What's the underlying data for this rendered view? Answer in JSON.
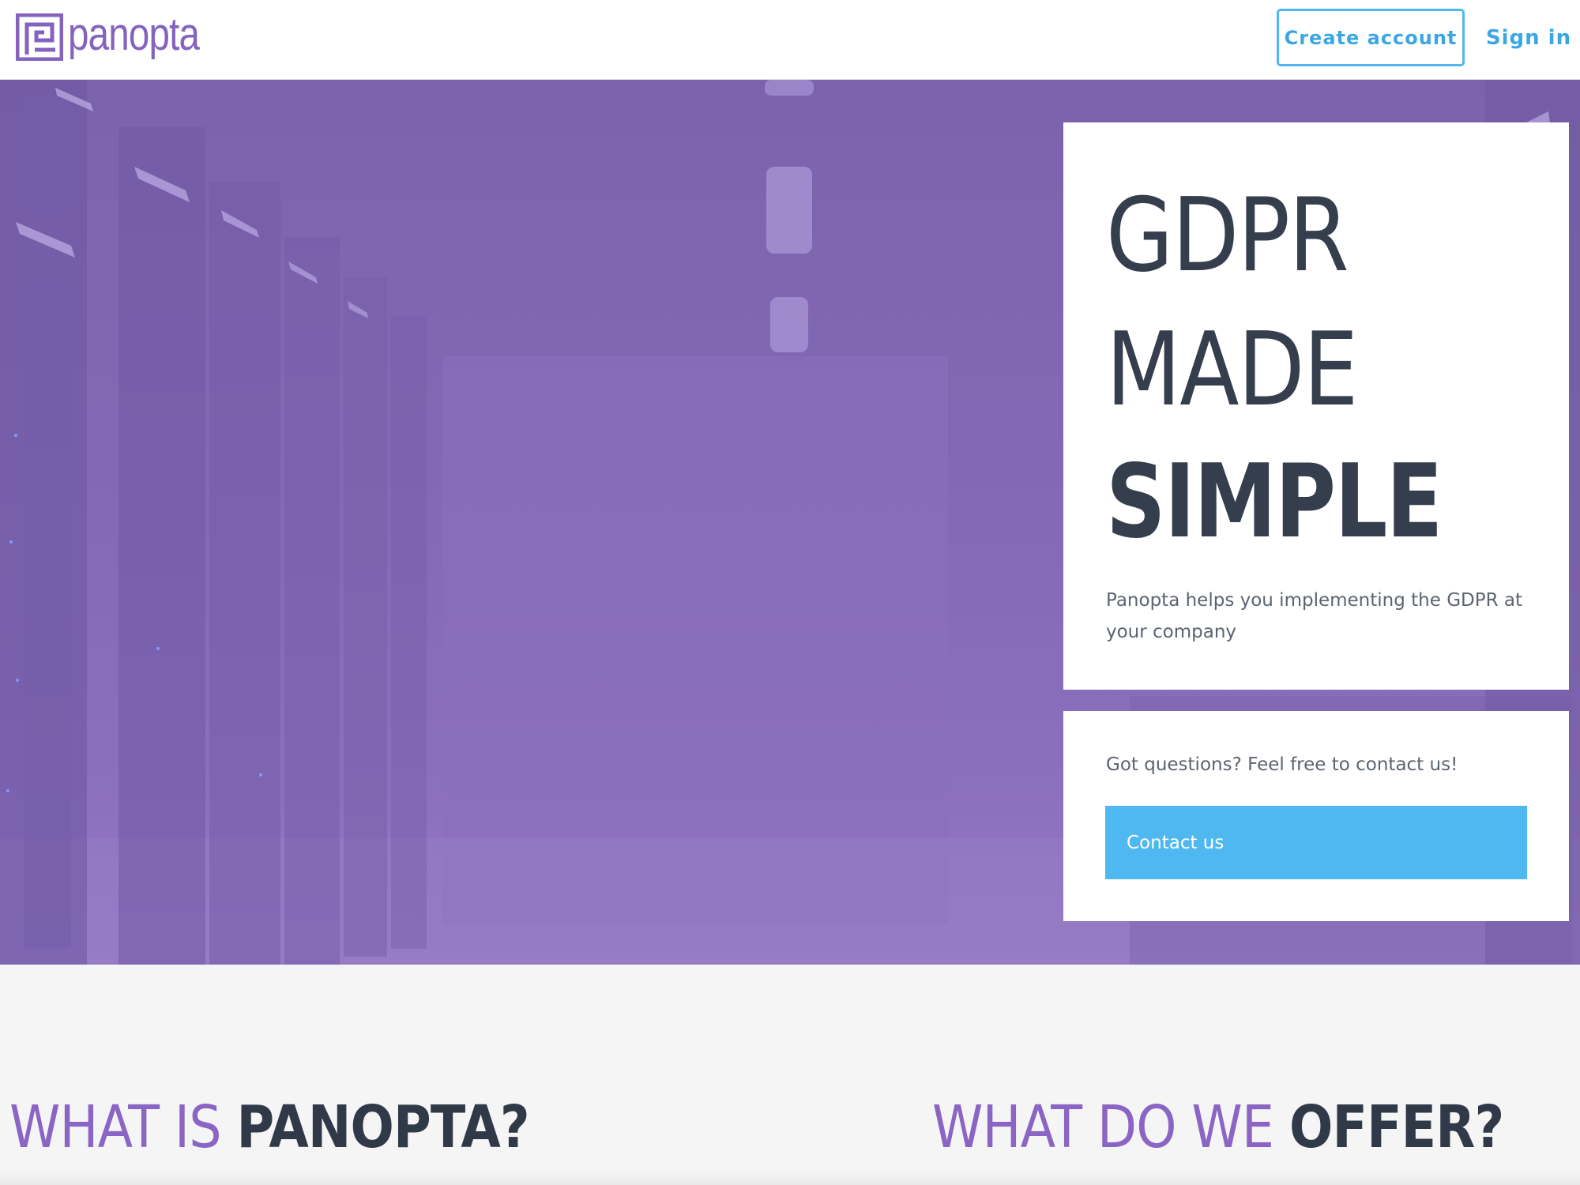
{
  "header": {
    "logo_text": "panopta",
    "create_account_label": "Create account",
    "sign_in_label": "Sign in"
  },
  "hero": {
    "headline_line1": "GDPR",
    "headline_line2": "MADE",
    "headline_line3": "SIMPLE",
    "subtitle": "Panopta helps you implementing the GDPR at your company",
    "contact_prompt": "Got questions? Feel free to contact us!",
    "contact_button_label": "Contact us"
  },
  "sections": {
    "what_is": {
      "part1": "WHAT IS",
      "part2": "PANOPTA?"
    },
    "what_offer": {
      "part1": "WHAT DO WE",
      "part2": "OFFER?"
    }
  },
  "colors": {
    "brand_purple": "#8463bf",
    "accent_blue": "#4fb8f0",
    "text_dark": "#343e4d"
  }
}
